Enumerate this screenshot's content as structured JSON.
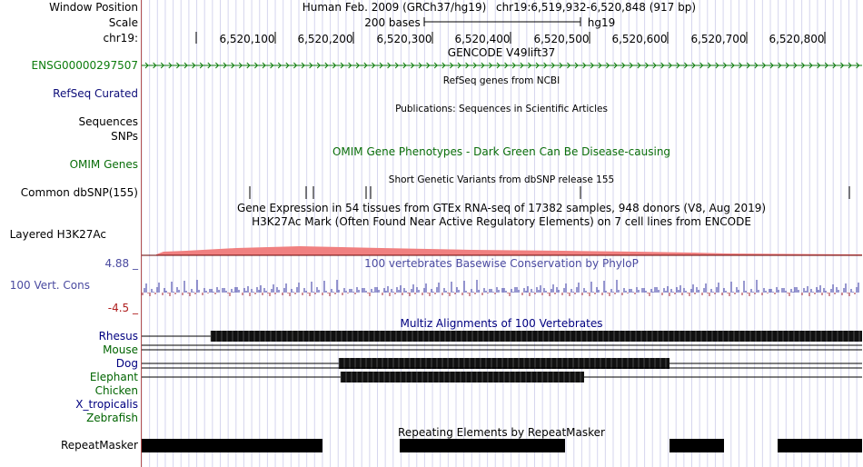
{
  "labels": {
    "window_position": "Window Position",
    "scale": "Scale",
    "chrom": "chr19:",
    "gene": "ENSG00000297507",
    "refseq": "RefSeq Curated",
    "sequences": "Sequences",
    "snps": "SNPs",
    "omim": "OMIM Genes",
    "dbsnp": "Common dbSNP(155)",
    "h3k27ac": "Layered H3K27Ac",
    "cons_max": "4.88 _",
    "cons": "100 Vert. Cons",
    "cons_min": "-4.5 _",
    "repeatmasker": "RepeatMasker"
  },
  "header": {
    "assembly": "Human Feb. 2009 (GRCh37/hg19)",
    "position": "chr19:6,519,932-6,520,848 (917 bp)",
    "scale_text": "200 bases",
    "db": "hg19"
  },
  "ruler_ticks": [
    "6,520,100",
    "6,520,200",
    "6,520,300",
    "6,520,400",
    "6,520,500",
    "6,520,600",
    "6,520,700",
    "6,520,800"
  ],
  "track_titles": {
    "gencode": "GENCODE V49lift37",
    "refseq": "RefSeq genes from NCBI",
    "publications": "Publications: Sequences in Scientific Articles",
    "omim": "OMIM Gene Phenotypes - Dark Green Can Be Disease-causing",
    "dbsnp": "Short Genetic Variants from dbSNP release 155",
    "gtex": "Gene Expression in 54 tissues from GTEx RNA-seq of 17382 samples, 948 donors (V8, Aug 2019)",
    "h3k27ac": "H3K27Ac Mark (Often Found Near Active Regulatory Elements) on 7 cell lines from ENCODE",
    "phylop": "100 vertebrates Basewise Conservation by PhyloP",
    "multiz": "Multiz Alignments of 100 Vertebrates",
    "repeatmasker": "Repeating Elements by RepeatMasker"
  },
  "species": [
    {
      "name": "Rhesus",
      "color": "#000080"
    },
    {
      "name": "Mouse",
      "color": "#006400"
    },
    {
      "name": "Dog",
      "color": "#000080"
    },
    {
      "name": "Elephant",
      "color": "#006400"
    },
    {
      "name": "Chicken",
      "color": "#006400"
    },
    {
      "name": "X_tropicalis",
      "color": "#000080"
    },
    {
      "name": "Zebrafish",
      "color": "#006400"
    }
  ],
  "colors": {
    "gene_green": "#0c7c0c",
    "refseq_blue": "#0c0c78",
    "omim_green": "#0a6e0a",
    "cons_blue": "#4a4aa0",
    "h3k27ac": "#f08080",
    "grid": "#d6d6ee",
    "frame_red": "#b45050"
  }
}
